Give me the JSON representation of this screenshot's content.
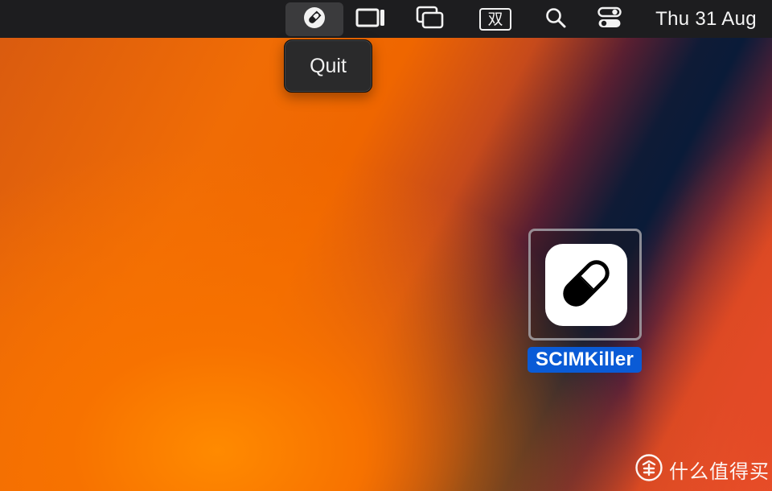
{
  "menubar": {
    "items": [
      {
        "name": "pill-menu-extra",
        "icon": "pill-icon",
        "active": true
      },
      {
        "name": "screen-mirroring",
        "icon": "screen-mirroring-icon"
      },
      {
        "name": "window-switcher",
        "icon": "windows-icon"
      },
      {
        "name": "input-method",
        "icon": "input-method-icon",
        "label": "双"
      },
      {
        "name": "spotlight",
        "icon": "search-icon"
      },
      {
        "name": "control-center",
        "icon": "control-center-icon"
      }
    ],
    "clock": "Thu 31 Aug"
  },
  "dropdown": {
    "items": [
      {
        "label": "Quit"
      }
    ]
  },
  "desktop_icon": {
    "label": "SCIMKiller",
    "icon": "pill-icon",
    "selected": true
  },
  "watermark": {
    "icon": "smzdm-logo-icon",
    "text": "什么值得买"
  },
  "colors": {
    "menubar_bg": "#1d1d1f",
    "selection_blue": "#0a5bd6",
    "menu_bg": "#2a2a2b"
  }
}
